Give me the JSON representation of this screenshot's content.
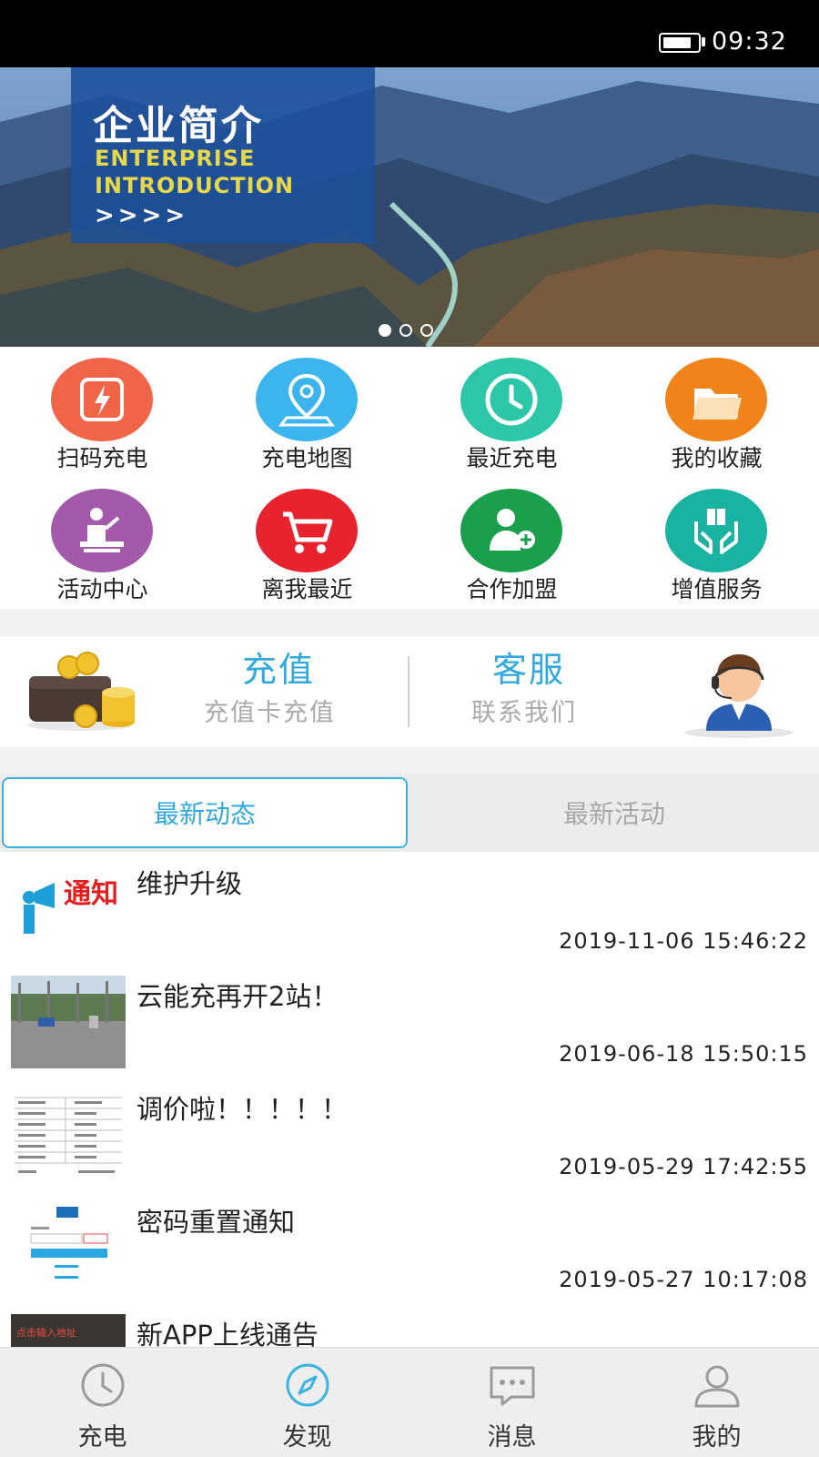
{
  "status_bar": {
    "time": "09:32",
    "battery_level": 0.8
  },
  "banner": {
    "title": "企业简介",
    "subtitle_line1": "ENTERPRISE",
    "subtitle_line2": "INTRODUCTION",
    "arrows": ">>>>",
    "page_count": 3,
    "active_page": 1
  },
  "grid": [
    {
      "label": "扫码充电",
      "icon": "scan-charge-icon",
      "color": "#f26448"
    },
    {
      "label": "充电地图",
      "icon": "map-pin-icon",
      "color": "#3cb5ee"
    },
    {
      "label": "最近充电",
      "icon": "clock-icon",
      "color": "#2bc7a8"
    },
    {
      "label": "我的收藏",
      "icon": "folder-icon",
      "color": "#f08319"
    },
    {
      "label": "活动中心",
      "icon": "presenter-icon",
      "color": "#a45aaa"
    },
    {
      "label": "离我最近",
      "icon": "cart-icon",
      "color": "#e8232f"
    },
    {
      "label": "合作加盟",
      "icon": "add-user-icon",
      "color": "#1a9f4b"
    },
    {
      "label": "增值服务",
      "icon": "gift-hands-icon",
      "color": "#19b3a3"
    }
  ],
  "services": {
    "recharge": {
      "title": "充值",
      "subtitle": "充值卡充值"
    },
    "support": {
      "title": "客服",
      "subtitle": "联系我们"
    }
  },
  "tabs": {
    "active": "最新动态",
    "inactive": "最新活动"
  },
  "news": [
    {
      "title": "维护升级",
      "time": "2019-11-06 15:46:22",
      "thumb": "notice-thumbnail",
      "thumb_text": "通知"
    },
    {
      "title": "云能充再开2站！",
      "time": "2019-06-18 15:50:15",
      "thumb": "station-photo-thumbnail"
    },
    {
      "title": "调价啦！！！！！",
      "time": "2019-05-29 17:42:55",
      "thumb": "price-table-thumbnail"
    },
    {
      "title": "密码重置通知",
      "time": "2019-05-27 10:17:08",
      "thumb": "login-form-thumbnail"
    },
    {
      "title": "新APP上线通告",
      "time": "",
      "thumb": "app-launch-thumbnail",
      "thumb_text": "点击输入地址"
    }
  ],
  "bottom_nav": [
    {
      "label": "充电",
      "icon": "clock-icon"
    },
    {
      "label": "发现",
      "icon": "compass-icon",
      "active": true
    },
    {
      "label": "消息",
      "icon": "chat-icon"
    },
    {
      "label": "我的",
      "icon": "user-icon"
    }
  ],
  "colors": {
    "accent": "#31a9de",
    "active_nav": "#3bb3e0",
    "inactive_text": "#a8a8a8"
  }
}
